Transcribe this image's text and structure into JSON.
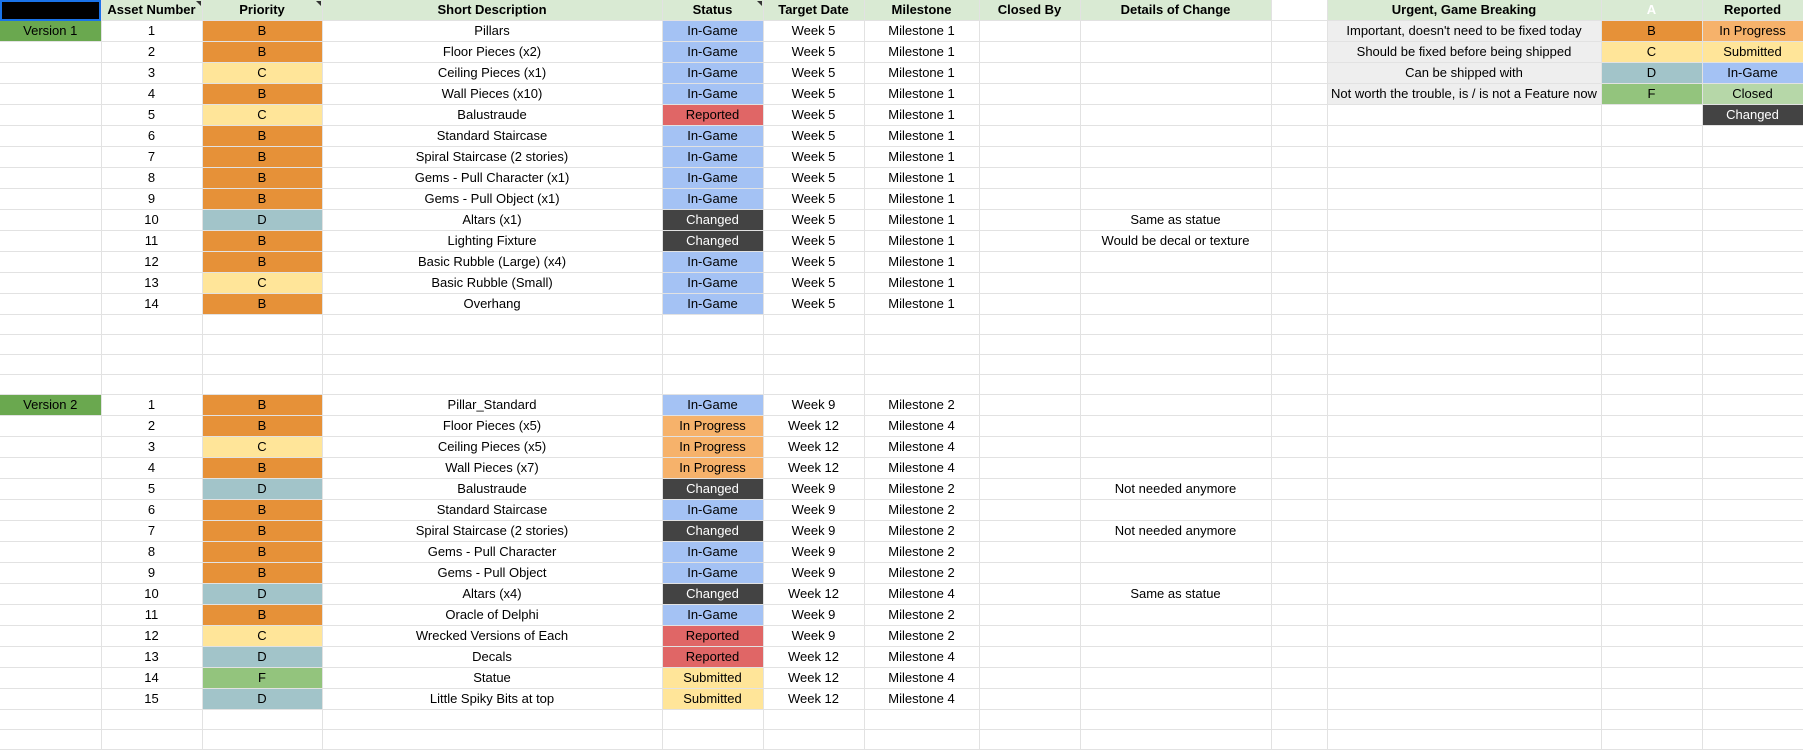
{
  "headers": [
    "",
    "Asset Number",
    "Priority",
    "Short Description",
    "Status",
    "Target Date",
    "Milestone",
    "Closed By",
    "Details of Change",
    "",
    "",
    "",
    ""
  ],
  "legend": [
    {
      "desc": "Urgent, Game Breaking",
      "priority": "A",
      "status": "Reported"
    },
    {
      "desc": "Important, doesn't need to be fixed today",
      "priority": "B",
      "status": "In Progress"
    },
    {
      "desc": "Should be fixed before being shipped",
      "priority": "C",
      "status": "Submitted"
    },
    {
      "desc": "Can be shipped with",
      "priority": "D",
      "status": "In-Game"
    },
    {
      "desc": "Not worth the trouble, is / is not a Feature now",
      "priority": "F",
      "status": "Closed"
    },
    {
      "desc": "",
      "priority": "",
      "status": "Changed"
    }
  ],
  "rows": [
    {
      "version": "Version 1",
      "num": "1",
      "priority": "B",
      "desc": "Pillars",
      "status": "In-Game",
      "target": "Week 5",
      "milestone": "Milestone 1",
      "closed_by": "",
      "details": ""
    },
    {
      "version": "",
      "num": "2",
      "priority": "B",
      "desc": "Floor Pieces (x2)",
      "status": "In-Game",
      "target": "Week 5",
      "milestone": "Milestone 1",
      "closed_by": "",
      "details": ""
    },
    {
      "version": "",
      "num": "3",
      "priority": "C",
      "desc": "Ceiling Pieces (x1)",
      "status": "In-Game",
      "target": "Week 5",
      "milestone": "Milestone 1",
      "closed_by": "",
      "details": ""
    },
    {
      "version": "",
      "num": "4",
      "priority": "B",
      "desc": "Wall Pieces (x10)",
      "status": "In-Game",
      "target": "Week 5",
      "milestone": "Milestone 1",
      "closed_by": "",
      "details": ""
    },
    {
      "version": "",
      "num": "5",
      "priority": "C",
      "desc": "Balustraude",
      "status": "Reported",
      "target": "Week 5",
      "milestone": "Milestone 1",
      "closed_by": "",
      "details": ""
    },
    {
      "version": "",
      "num": "6",
      "priority": "B",
      "desc": "Standard Staircase",
      "status": "In-Game",
      "target": "Week 5",
      "milestone": "Milestone 1",
      "closed_by": "",
      "details": ""
    },
    {
      "version": "",
      "num": "7",
      "priority": "B",
      "desc": "Spiral Staircase (2 stories)",
      "status": "In-Game",
      "target": "Week 5",
      "milestone": "Milestone 1",
      "closed_by": "",
      "details": ""
    },
    {
      "version": "",
      "num": "8",
      "priority": "B",
      "desc": "Gems - Pull Character (x1)",
      "status": "In-Game",
      "target": "Week 5",
      "milestone": "Milestone 1",
      "closed_by": "",
      "details": ""
    },
    {
      "version": "",
      "num": "9",
      "priority": "B",
      "desc": "Gems - Pull Object (x1)",
      "status": "In-Game",
      "target": "Week 5",
      "milestone": "Milestone 1",
      "closed_by": "",
      "details": ""
    },
    {
      "version": "",
      "num": "10",
      "priority": "D",
      "desc": "Altars (x1)",
      "status": "Changed",
      "target": "Week 5",
      "milestone": "Milestone 1",
      "closed_by": "",
      "details": "Same as statue"
    },
    {
      "version": "",
      "num": "11",
      "priority": "B",
      "desc": "Lighting Fixture",
      "status": "Changed",
      "target": "Week 5",
      "milestone": "Milestone 1",
      "closed_by": "",
      "details": "Would be decal or texture"
    },
    {
      "version": "",
      "num": "12",
      "priority": "B",
      "desc": "Basic Rubble (Large) (x4)",
      "status": "In-Game",
      "target": "Week 5",
      "milestone": "Milestone 1",
      "closed_by": "",
      "details": ""
    },
    {
      "version": "",
      "num": "13",
      "priority": "C",
      "desc": "Basic Rubble (Small)",
      "status": "In-Game",
      "target": "Week 5",
      "milestone": "Milestone 1",
      "closed_by": "",
      "details": ""
    },
    {
      "version": "",
      "num": "14",
      "priority": "B",
      "desc": "Overhang",
      "status": "In-Game",
      "target": "Week 5",
      "milestone": "Milestone 1",
      "closed_by": "",
      "details": ""
    },
    {
      "version": "",
      "num": "",
      "priority": "",
      "desc": "",
      "status": "",
      "target": "",
      "milestone": "",
      "closed_by": "",
      "details": ""
    },
    {
      "version": "",
      "num": "",
      "priority": "",
      "desc": "",
      "status": "",
      "target": "",
      "milestone": "",
      "closed_by": "",
      "details": ""
    },
    {
      "version": "",
      "num": "",
      "priority": "",
      "desc": "",
      "status": "",
      "target": "",
      "milestone": "",
      "closed_by": "",
      "details": ""
    },
    {
      "version": "",
      "num": "",
      "priority": "",
      "desc": "",
      "status": "",
      "target": "",
      "milestone": "",
      "closed_by": "",
      "details": ""
    },
    {
      "version": "Version 2",
      "num": "1",
      "priority": "B",
      "desc": "Pillar_Standard",
      "status": "In-Game",
      "target": "Week 9",
      "milestone": "Milestone 2",
      "closed_by": "",
      "details": ""
    },
    {
      "version": "",
      "num": "2",
      "priority": "B",
      "desc": "Floor Pieces (x5)",
      "status": "In Progress",
      "target": "Week 12",
      "milestone": "Milestone 4",
      "closed_by": "",
      "details": ""
    },
    {
      "version": "",
      "num": "3",
      "priority": "C",
      "desc": "Ceiling Pieces (x5)",
      "status": "In Progress",
      "target": "Week 12",
      "milestone": "Milestone 4",
      "closed_by": "",
      "details": ""
    },
    {
      "version": "",
      "num": "4",
      "priority": "B",
      "desc": "Wall Pieces (x7)",
      "status": "In Progress",
      "target": "Week 12",
      "milestone": "Milestone 4",
      "closed_by": "",
      "details": ""
    },
    {
      "version": "",
      "num": "5",
      "priority": "D",
      "desc": "Balustraude",
      "status": "Changed",
      "target": "Week 9",
      "milestone": "Milestone 2",
      "closed_by": "",
      "details": "Not needed anymore"
    },
    {
      "version": "",
      "num": "6",
      "priority": "B",
      "desc": "Standard Staircase",
      "status": "In-Game",
      "target": "Week 9",
      "milestone": "Milestone 2",
      "closed_by": "",
      "details": ""
    },
    {
      "version": "",
      "num": "7",
      "priority": "B",
      "desc": "Spiral Staircase (2 stories)",
      "status": "Changed",
      "target": "Week 9",
      "milestone": "Milestone 2",
      "closed_by": "",
      "details": "Not needed anymore"
    },
    {
      "version": "",
      "num": "8",
      "priority": "B",
      "desc": "Gems - Pull Character",
      "status": "In-Game",
      "target": "Week 9",
      "milestone": "Milestone 2",
      "closed_by": "",
      "details": ""
    },
    {
      "version": "",
      "num": "9",
      "priority": "B",
      "desc": "Gems - Pull Object",
      "status": "In-Game",
      "target": "Week 9",
      "milestone": "Milestone 2",
      "closed_by": "",
      "details": ""
    },
    {
      "version": "",
      "num": "10",
      "priority": "D",
      "desc": "Altars (x4)",
      "status": "Changed",
      "target": "Week 12",
      "milestone": "Milestone 4",
      "closed_by": "",
      "details": "Same as statue"
    },
    {
      "version": "",
      "num": "11",
      "priority": "B",
      "desc": "Oracle of Delphi",
      "status": "In-Game",
      "target": "Week 9",
      "milestone": "Milestone 2",
      "closed_by": "",
      "details": ""
    },
    {
      "version": "",
      "num": "12",
      "priority": "C",
      "desc": "Wrecked Versions of Each",
      "status": "Reported",
      "target": "Week 9",
      "milestone": "Milestone 2",
      "closed_by": "",
      "details": ""
    },
    {
      "version": "",
      "num": "13",
      "priority": "D",
      "desc": "Decals",
      "status": "Reported",
      "target": "Week 12",
      "milestone": "Milestone 4",
      "closed_by": "",
      "details": ""
    },
    {
      "version": "",
      "num": "14",
      "priority": "F",
      "desc": "Statue",
      "status": "Submitted",
      "target": "Week 12",
      "milestone": "Milestone 4",
      "closed_by": "",
      "details": ""
    },
    {
      "version": "",
      "num": "15",
      "priority": "D",
      "desc": "Little Spiky Bits at top",
      "status": "Submitted",
      "target": "Week 12",
      "milestone": "Milestone 4",
      "closed_by": "",
      "details": ""
    },
    {
      "version": "",
      "num": "",
      "priority": "",
      "desc": "",
      "status": "",
      "target": "",
      "milestone": "",
      "closed_by": "",
      "details": ""
    },
    {
      "version": "",
      "num": "",
      "priority": "",
      "desc": "",
      "status": "",
      "target": "",
      "milestone": "",
      "closed_by": "",
      "details": ""
    }
  ]
}
